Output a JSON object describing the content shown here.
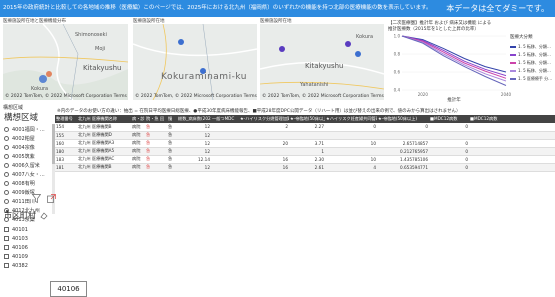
{
  "banner": {
    "title": "2015年の政府統計と比較しての各地域の推移（医療編）このページでは、2025年における北九州（福岡県）のいずれかの機能を持つ北部の医療機能の数を表示しています。",
    "right": "本データは全てダミーです。"
  },
  "maps": [
    {
      "label": "医療施設所在地と医療機能分布",
      "bigplace": "",
      "places": [
        "Shimonoseki",
        "Kitakyushu",
        "Moji",
        "Kokura"
      ]
    },
    {
      "label": "医療施設所在地",
      "bigplace": "Kokuraminami-ku",
      "places": []
    },
    {
      "label": "医療施設所在地",
      "bigplace": "",
      "places": [
        "Kitakyushu",
        "Yahatanishi",
        "Kokura"
      ]
    }
  ],
  "map_credit": "© 2022 TomTom, © 2022 Microsoft Corporation  Terms",
  "chart_data": {
    "type": "line",
    "title": "【二次医療圏】推計年 および 病床又は機能 による",
    "subtitle": "推計医療数（2015年を1とした上昇の比率）",
    "x": [
      2015,
      2020,
      2025,
      2030,
      2035,
      2040
    ],
    "xlabel": "推計年",
    "ylabel": "",
    "ylim": [
      0.4,
      1.0
    ],
    "xticks": [
      "2020",
      "2040"
    ],
    "yticks": [
      "1.0",
      "0.8",
      "0.6",
      "0.4"
    ],
    "legend_title": "医療大分類",
    "series": [
      {
        "name": "1. 5 転移、分類…",
        "color": "#3344aa",
        "values": [
          1.0,
          0.96,
          0.86,
          0.75,
          0.66,
          0.6
        ]
      },
      {
        "name": "1. 5 転移、分類…",
        "color": "#8844cc",
        "values": [
          1.0,
          0.95,
          0.84,
          0.72,
          0.63,
          0.56
        ]
      },
      {
        "name": "1. 5 転移、分類…",
        "color": "#cc44aa",
        "values": [
          1.0,
          0.94,
          0.82,
          0.7,
          0.61,
          0.53
        ]
      },
      {
        "name": "1. 5 転移、分類…",
        "color": "#aa88dd",
        "values": [
          1.0,
          0.93,
          0.8,
          0.68,
          0.58,
          0.5
        ]
      },
      {
        "name": "1. 5 医療療手 分…",
        "color": "#6666bb",
        "values": [
          1.0,
          0.92,
          0.78,
          0.66,
          0.55,
          0.45
        ]
      }
    ]
  },
  "sidebar": {
    "section_label": "構想区域",
    "title": "構想区域",
    "items": [
      {
        "label": "4001福岡・…",
        "checked": false
      },
      {
        "label": "4002粕屋",
        "checked": false
      },
      {
        "label": "4004宗像",
        "checked": false
      },
      {
        "label": "4005筑紫",
        "checked": false
      },
      {
        "label": "4006久留米",
        "checked": false
      },
      {
        "label": "4007八女・…",
        "checked": false
      },
      {
        "label": "4008有明",
        "checked": false
      },
      {
        "label": "4009飯塚",
        "checked": false
      },
      {
        "label": "4011田川",
        "checked": false
      },
      {
        "label": "4012北九州",
        "checked": true
      },
      {
        "label": "4013京築",
        "checked": false
      }
    ],
    "city_title": "市区町村",
    "cities": [
      "40101",
      "40103",
      "40106",
      "40109",
      "40382"
    ],
    "tooltip": "40106"
  },
  "table": {
    "note": "※内のデータのお使い方の違い：抽出 = 在院日平均医療日総医療、●平成30年度病床機能報告、■平成28年度DPC公開データ（リハ一ト用）は並び替えの出来の例で、値のみから算出はされません）",
    "headers": [
      "整理番号",
      "北九州 医療機関名称",
      "病・診",
      "院・急",
      "回",
      "慢",
      "総数_病床数(2025)",
      "一般つMDC",
      "★-ハイリスク分娩管理加算",
      "★-帝臨地(50床以上)",
      "★ハイリスク妊産婦共同管理料１",
      "★-帝臨地(50床以上)",
      "■MDC12病数",
      "■MDC12病数"
    ],
    "rows": [
      [
        "154",
        "北九州 医療機関B",
        "病院",
        "急",
        "",
        "急",
        "12",
        "",
        "2",
        "2.27",
        "0",
        "0",
        "0",
        ""
      ],
      [
        "155",
        "北九州 医療機関D",
        "病院",
        "急",
        "",
        "急",
        "12",
        "",
        "",
        "",
        "",
        "",
        "",
        ""
      ],
      [
        "160",
        "北九州 医療機関A3",
        "病院",
        "急",
        "",
        "急",
        "12",
        "",
        "20",
        "3.71",
        "10",
        "2.65714857",
        "0",
        ""
      ],
      [
        "180",
        "北九州 医療機関A5",
        "病院",
        "急",
        "",
        "急",
        "12",
        "",
        "",
        "1",
        "",
        "0.212765957",
        "0",
        ""
      ],
      [
        "183",
        "北九州 医療機関AC",
        "病院",
        "急",
        "",
        "急",
        "12.14",
        "",
        "16",
        "2.30",
        "10",
        "1.435785106",
        "0",
        ""
      ],
      [
        "181",
        "北九州 医療機関B",
        "病院",
        "急",
        "",
        "急",
        "12",
        "",
        "16",
        "2.61",
        "4",
        "0.653594771",
        "0",
        ""
      ]
    ]
  }
}
